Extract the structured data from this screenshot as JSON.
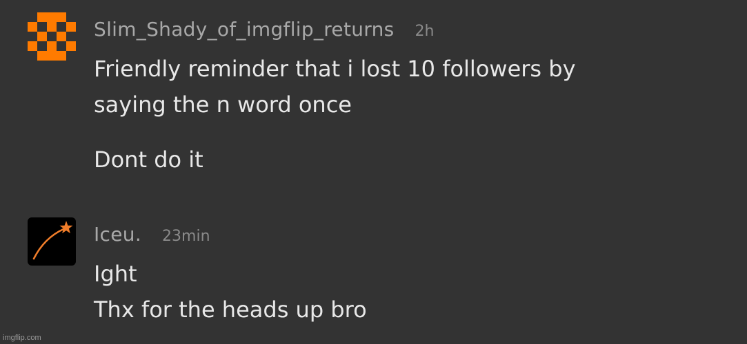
{
  "comments": [
    {
      "username": "Slim_Shady_of_imgflip_returns",
      "timestamp": "2h",
      "avatar_icon": "orange-pixel-checker-icon",
      "avatar_color": "#ff7b00",
      "lines": [
        "Friendly reminder that i lost 10 followers by",
        "saying the n word once"
      ],
      "lines_after_gap": [
        "Dont do it"
      ]
    },
    {
      "username": "Iceu.",
      "timestamp": "23min",
      "avatar_icon": "shooting-star-icon",
      "avatar_color": "#f07d2a",
      "lines": [
        "Ight",
        "Thx for the heads up bro"
      ]
    }
  ],
  "watermark": "imgflip.com"
}
